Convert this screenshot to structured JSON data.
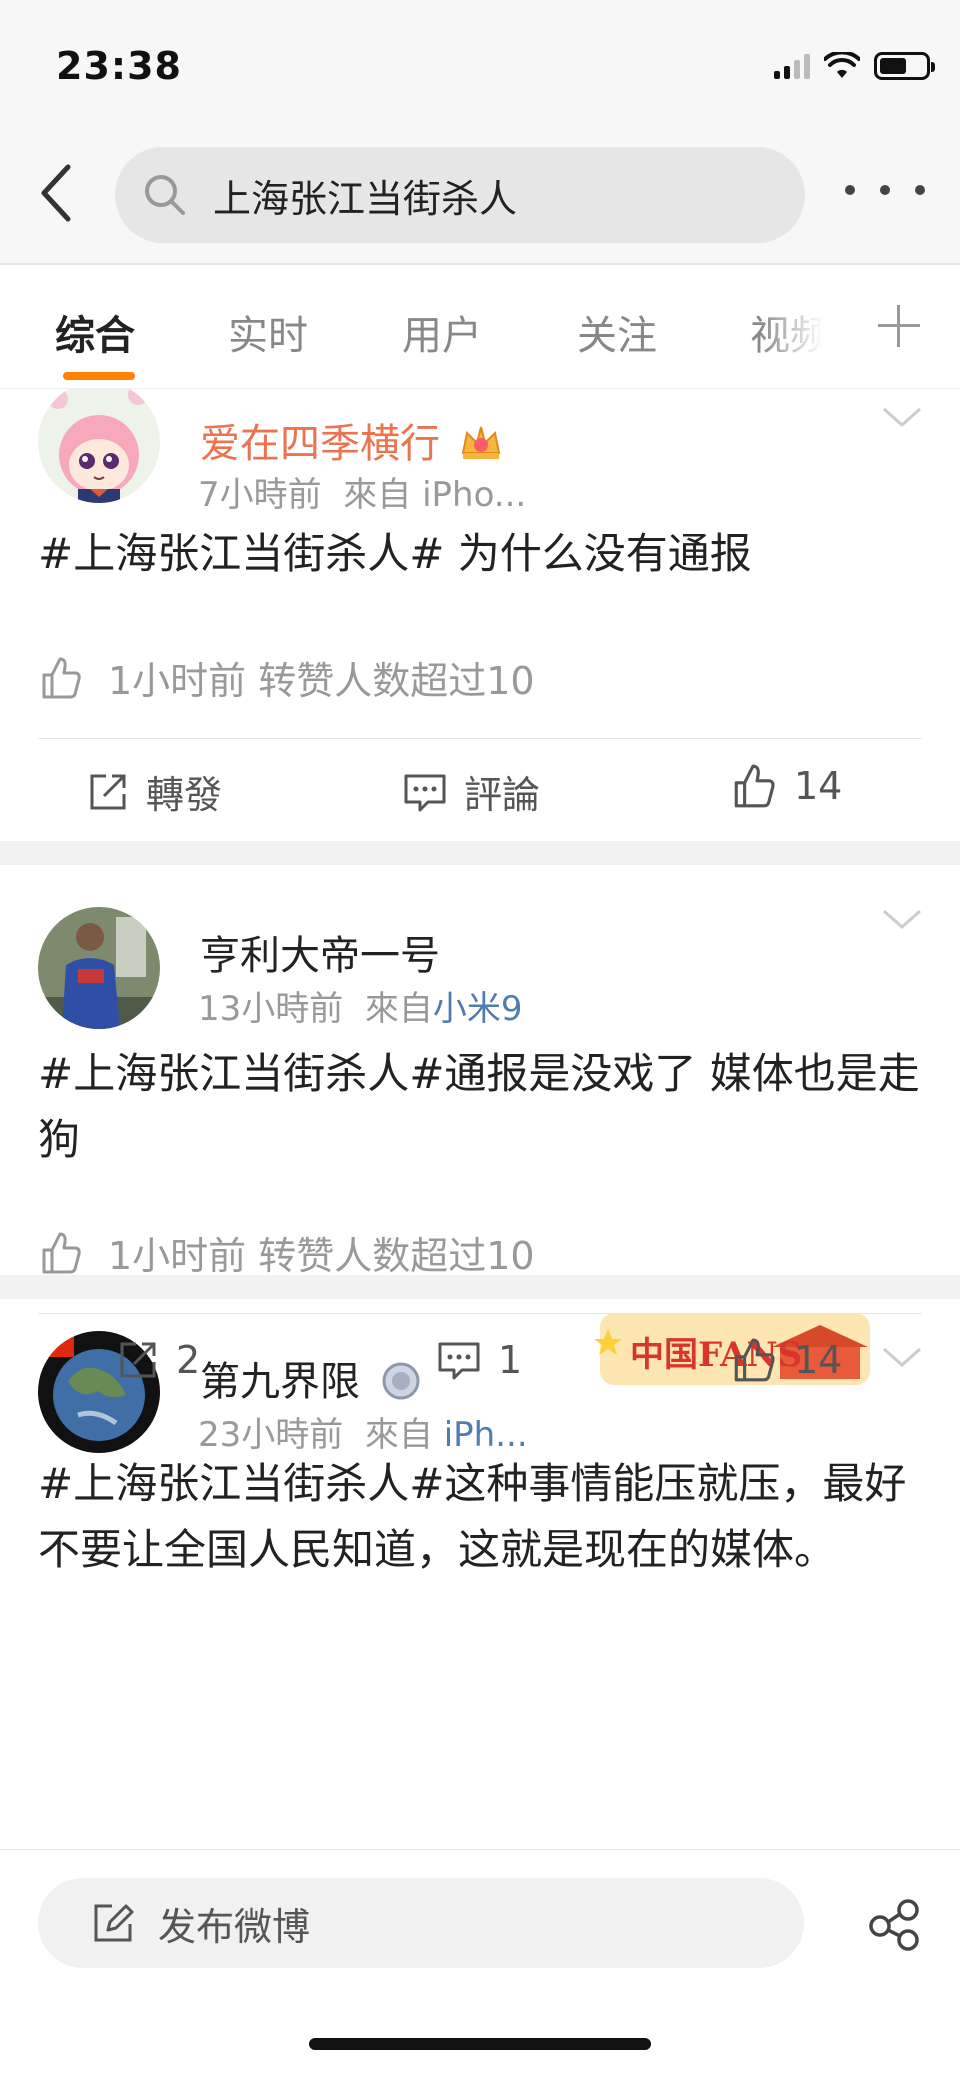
{
  "status_bar": {
    "time": "23:38"
  },
  "search": {
    "query": "上海张江当街杀人"
  },
  "tabs": [
    {
      "label": "综合",
      "active": true
    },
    {
      "label": "实时",
      "active": false
    },
    {
      "label": "用户",
      "active": false
    },
    {
      "label": "关注",
      "active": false
    },
    {
      "label": "视频",
      "active": false
    }
  ],
  "posts": [
    {
      "username": "爱在四季横行",
      "time": "7小時前",
      "source_prefix": "來自",
      "source": "iPho...",
      "text": "#上海张江当街杀人# 为什么没有通报",
      "like_info": "1小时前 转赞人数超过10",
      "repost_label": "轉發",
      "comment_label": "評論",
      "like_count": "14"
    },
    {
      "username": "亨利大帝一号",
      "time": "13小時前",
      "source_prefix": "來自",
      "source": "小米9",
      "text": "#上海张江当街杀人#通报是没戏了 媒体也是走狗",
      "like_info": "1小时前 转赞人数超过10",
      "repost_count": "2",
      "comment_count": "1",
      "like_count": "14"
    },
    {
      "username": "第九界限",
      "time": "23小時前",
      "source_prefix": "來自",
      "source": "iPh...",
      "badge_text": "中国FANS",
      "text": "#上海张江当街杀人#这种事情能压就压，最好不要让全国人民知道，这就是现在的媒体。"
    }
  ],
  "bottom_bar": {
    "compose_label": "发布微博"
  },
  "colors": {
    "accent": "#ff8200",
    "vip_name": "#eb7350",
    "source_link": "#507daf"
  }
}
